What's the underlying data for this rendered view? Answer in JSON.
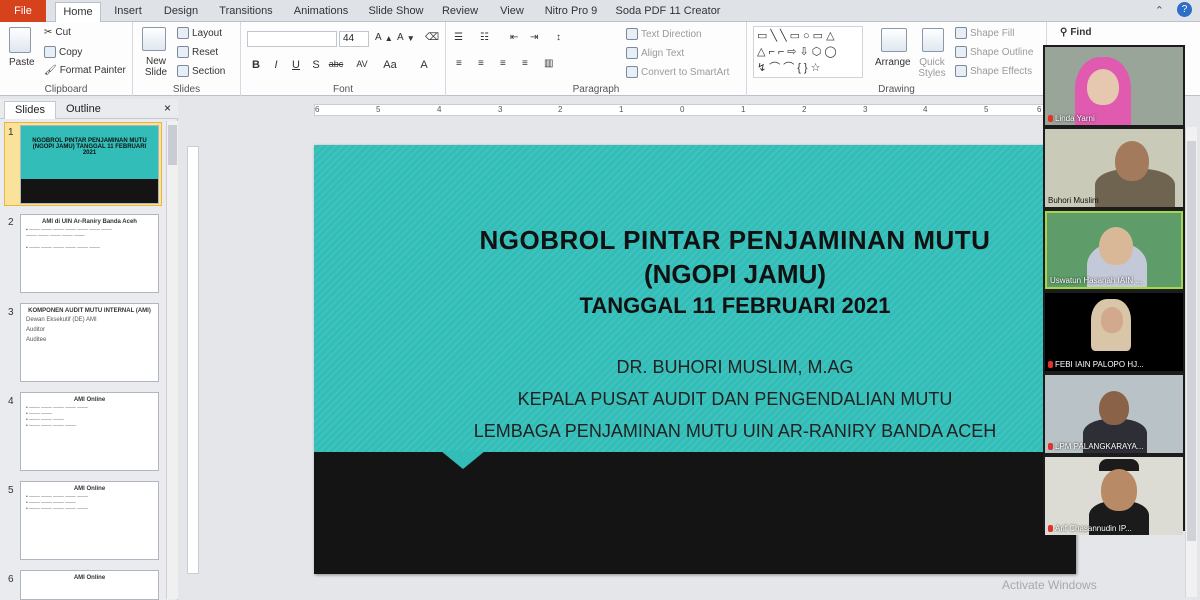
{
  "tabs": {
    "file": "File",
    "items": [
      "Home",
      "Insert",
      "Design",
      "Transitions",
      "Animations",
      "Slide Show",
      "Review",
      "View",
      "Nitro Pro 9",
      "Soda PDF 11 Creator"
    ]
  },
  "ribbon": {
    "clipboard": {
      "paste": "Paste",
      "cut": "Cut",
      "copy": "Copy",
      "format_painter": "Format Painter",
      "label": "Clipboard"
    },
    "slides": {
      "new_slide": "New Slide",
      "layout": "Layout",
      "reset": "Reset",
      "section": "Section",
      "label": "Slides"
    },
    "font": {
      "size": "44",
      "label": "Font"
    },
    "paragraph": {
      "text_direction": "Text Direction",
      "align_text": "Align Text",
      "convert": "Convert to SmartArt",
      "label": "Paragraph"
    },
    "drawing": {
      "arrange": "Arrange",
      "quick_styles": "Quick Styles",
      "shape_fill": "Shape Fill",
      "shape_outline": "Shape Outline",
      "shape_effects": "Shape Effects",
      "label": "Drawing"
    },
    "editing": {
      "find": "Find"
    }
  },
  "pane": {
    "tab_slides": "Slides",
    "tab_outline": "Outline"
  },
  "thumbnails": [
    {
      "num": "1",
      "title": "NGOBROL PINTAR PENJAMINAN MUTU (NGOPI JAMU) TANGGAL 11 FEBRUARI 2021"
    },
    {
      "num": "2",
      "title": "AMI di UIN Ar-Raniry Banda Aceh"
    },
    {
      "num": "3",
      "title": "KOMPONEN AUDIT MUTU INTERNAL (AMI)",
      "lines": [
        "Dewan Eksekutif (DE) AMI",
        "Auditor",
        "Auditee"
      ]
    },
    {
      "num": "4",
      "title": "AMI Online"
    },
    {
      "num": "5",
      "title": "AMI Online"
    },
    {
      "num": "6",
      "title": "AMI Online"
    }
  ],
  "ruler": {
    "marks": [
      "6",
      "5",
      "4",
      "3",
      "2",
      "1",
      "0",
      "1",
      "2",
      "3",
      "4",
      "5",
      "6"
    ]
  },
  "slide": {
    "title1": "NGOBROL PINTAR PENJAMINAN MUTU",
    "title2": "(NGOPI JAMU)",
    "title3": "TANGGAL 11 FEBRUARI 2021",
    "sub1": "DR. BUHORI MUSLIM, M.AG",
    "sub2": "KEPALA PUSAT AUDIT DAN PENGENDALIAN MUTU",
    "sub3": "LEMBAGA PENJAMINAN MUTU UIN AR-RANIRY BANDA ACEH"
  },
  "participants": [
    {
      "name": "Linda Yarni",
      "muted": true
    },
    {
      "name": "Buhori Muslim",
      "muted": false
    },
    {
      "name": "Uswatun Hasanah IAIN ...",
      "muted": false
    },
    {
      "name": "FEBI IAIN PALOPO HJ...",
      "muted": true
    },
    {
      "name": "LPM PALANGKARAYA...",
      "muted": true
    },
    {
      "name": "Arif Chasannudin IP...",
      "muted": true
    }
  ],
  "watermark": "Activate Windows",
  "colors": {
    "slide_teal": "#32bdb8",
    "slide_dark": "#141414",
    "file_tab": "#d5421b"
  }
}
